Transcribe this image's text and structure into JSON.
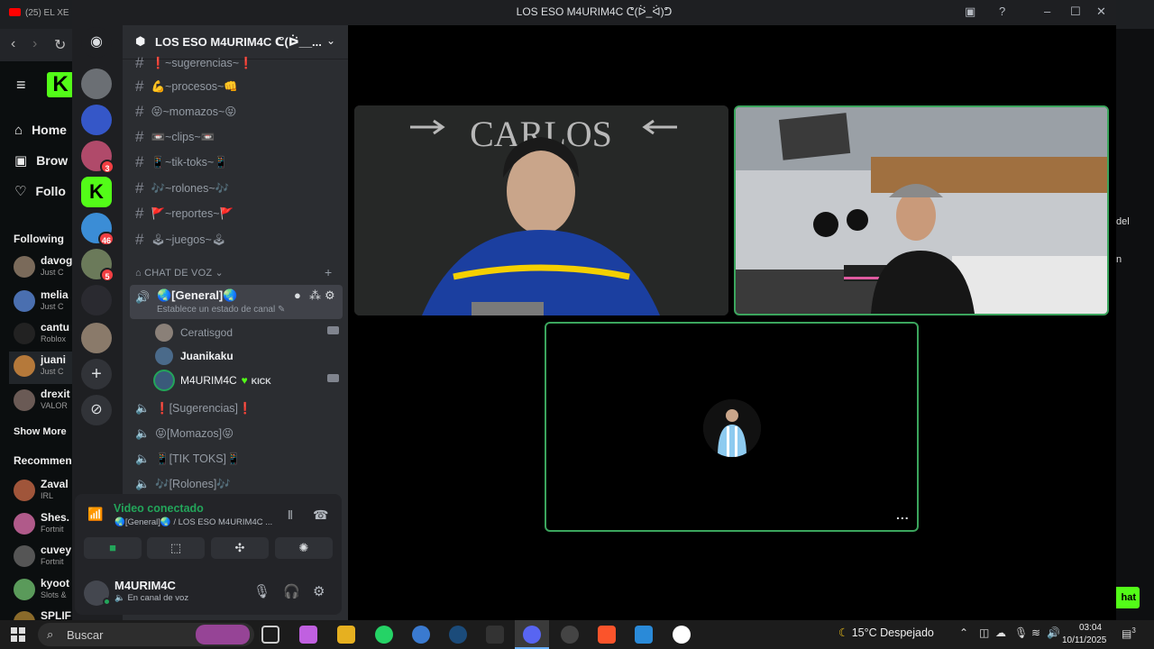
{
  "browser": {
    "tab_title": "(25) EL XE",
    "kick_menu": [
      {
        "icon": "home-icon",
        "label": "Home"
      },
      {
        "icon": "browse-icon",
        "label": "Brow"
      },
      {
        "icon": "heart-icon",
        "label": "Follo"
      }
    ],
    "following_heading": "Following",
    "following": [
      {
        "name": "davog",
        "sub": "Just C"
      },
      {
        "name": "melia",
        "sub": "Just C"
      },
      {
        "name": "cantu",
        "sub": "Roblox"
      },
      {
        "name": "juani",
        "sub": "Just C"
      },
      {
        "name": "drexit",
        "sub": "VALOR"
      }
    ],
    "show_more": "Show More",
    "recommended_heading": "Recommen",
    "recommended": [
      {
        "name": "Zaval",
        "sub": "IRL"
      },
      {
        "name": "Shes.",
        "sub": "Fortnit"
      },
      {
        "name": "cuvey",
        "sub": "Fortnit"
      },
      {
        "name": "kyoot",
        "sub": "Slots &"
      },
      {
        "name": "SPLIF",
        "sub": ""
      }
    ],
    "right_edge_text_1": "del",
    "right_edge_text_2": "n",
    "chat_button": "hat"
  },
  "discord": {
    "window_title": "LOS ESO M4URIM4C ᕦ(ᐖ_ᐛ)ᕤ",
    "guild_name": "LOS ESO M4URIM4C ᕦ(ᐖ__...",
    "server_badges": [
      "3",
      "46",
      "5"
    ],
    "text_channels": [
      "❗~sugerencias~❗",
      "💪~procesos~👊",
      "😝~momazos~😝",
      "📼~clips~📼",
      "📱~tik-toks~📱",
      "🎶~rolones~🎶",
      "🚩~reportes~🚩",
      "🕹~juegos~🕹"
    ],
    "voice_category": "CHAT DE VOZ",
    "active_voice": {
      "name": "🌏[General]🌏",
      "status_placeholder": "Establece un estado de canal"
    },
    "voice_users": [
      {
        "name": "Ceratisgod",
        "has_camera": true
      },
      {
        "name": "Juanikaku",
        "has_camera": false
      },
      {
        "name": "M4URIM4C",
        "badge": "KICK",
        "has_camera": true
      }
    ],
    "other_voice_channels": [
      "❗[Sugerencias]❗",
      "😝[Momazos]😝",
      "📱[TIK TOKS]📱",
      "🎶[Rolones]🎶"
    ],
    "rtc": {
      "title": "Video conectado",
      "subtitle": "🌏[General]🌏 / LOS ESO M4URIM4C ..."
    },
    "user": {
      "name": "M4URIM4C",
      "status": "En canal de voz"
    },
    "video_tiles": [
      {
        "label": "CARLOS"
      },
      {
        "label": ""
      },
      {
        "label": ""
      }
    ],
    "more_button": "..."
  },
  "taskbar": {
    "search_placeholder": "Buscar",
    "weather": "15°C  Despejado",
    "time": "03:04",
    "date": "10/11/2025",
    "notif_count": "3"
  }
}
